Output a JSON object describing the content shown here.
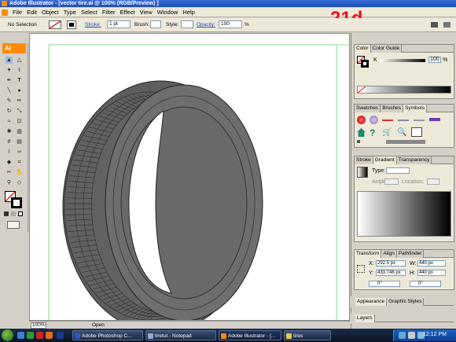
{
  "window": {
    "title": "Adobe Illustrator - [vector tire.ai @ 100% (RGB/Preview) ]"
  },
  "badge": "21d",
  "menu": [
    "File",
    "Edit",
    "Object",
    "Type",
    "Select",
    "Filter",
    "Effect",
    "View",
    "Window",
    "Help"
  ],
  "control": {
    "selection": "No Selection",
    "stroke_label": "Stroke:",
    "stroke_value": "1 pt",
    "brush_label": "Brush:",
    "style_label": "Style:",
    "opacity_label": "Opacity:",
    "opacity_value": "100",
    "percent": "%"
  },
  "toolbox": {
    "header": "Ai"
  },
  "status": {
    "zoom": "100%",
    "mode": "Open"
  },
  "panels": {
    "color": {
      "tab1": "Color",
      "tab2": "Color Guide",
      "channel": "K",
      "value": "100",
      "unit": "%"
    },
    "swatches": {
      "tab1": "Swatches",
      "tab2": "Brushes",
      "tab3": "Symbols"
    },
    "gradient": {
      "tab1": "Stroke",
      "tab2": "Gradient",
      "tab3": "Transparency",
      "type_label": "Type:",
      "angle_label": "Angle:",
      "location_label": "Location:"
    },
    "transform": {
      "tab1": "Transform",
      "tab2": "Align",
      "tab3": "Pathfinder",
      "x_label": "X:",
      "x": "292.5 px",
      "y_label": "Y:",
      "y": "433.746 px",
      "w_label": "W:",
      "w": "440 px",
      "h_label": "H:",
      "h": "440 px",
      "rot": "0°",
      "shear": "0°"
    },
    "appearance": {
      "tab1": "Appearance",
      "tab2": "Graphic Styles"
    },
    "layers": {
      "tab1": "Layers"
    }
  },
  "taskbar": {
    "items": [
      "Adobe Photoshop C...",
      "tiretut - Notepad",
      "Adobe Illustrator - [...",
      "tires"
    ],
    "clock": "12:12 PM"
  },
  "colors": {
    "tire": "#6a6a6a",
    "tire_dark": "#555555",
    "accent": "#ff8a00",
    "badge": "#e8141e"
  }
}
